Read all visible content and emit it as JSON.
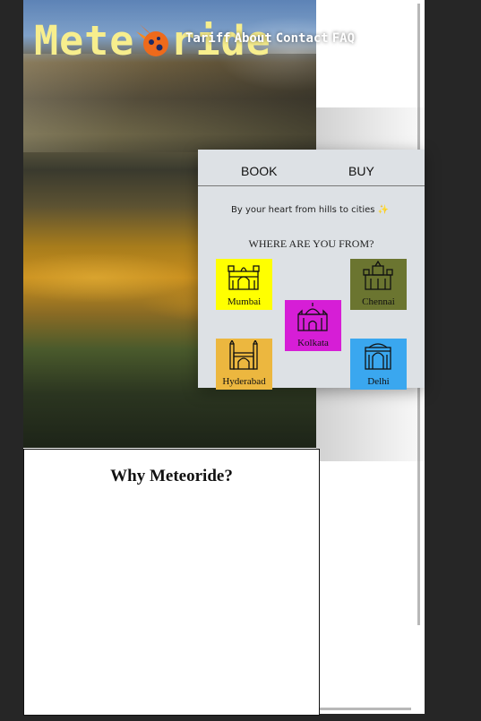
{
  "brand": {
    "logo_left": "Mete",
    "logo_right": "ride"
  },
  "nav": {
    "items": [
      "Tariff",
      "About",
      "Contact",
      "FAQ"
    ]
  },
  "panel": {
    "tabs": [
      "BOOK",
      "BUY"
    ],
    "tagline": "By your heart from hills to cities ✨",
    "where_heading": "WHERE ARE YOU FROM?",
    "cities": [
      {
        "name": "Mumbai",
        "color": "#ffff00",
        "icon": "gateway-icon"
      },
      {
        "name": "Chennai",
        "color": "#6b7530",
        "icon": "temple-icon"
      },
      {
        "name": "Kolkata",
        "color": "#d61ed6",
        "icon": "victoria-memorial-icon"
      },
      {
        "name": "Hyderabad",
        "color": "#ecb73f",
        "icon": "charminar-icon"
      },
      {
        "name": "Delhi",
        "color": "#3aa7ef",
        "icon": "india-gate-icon"
      }
    ]
  },
  "why": {
    "title": "Why Meteoride?"
  },
  "colors": {
    "logo": "#f7ee8d",
    "panel_bg": "#dde1e5",
    "page_bg": "#262626"
  }
}
